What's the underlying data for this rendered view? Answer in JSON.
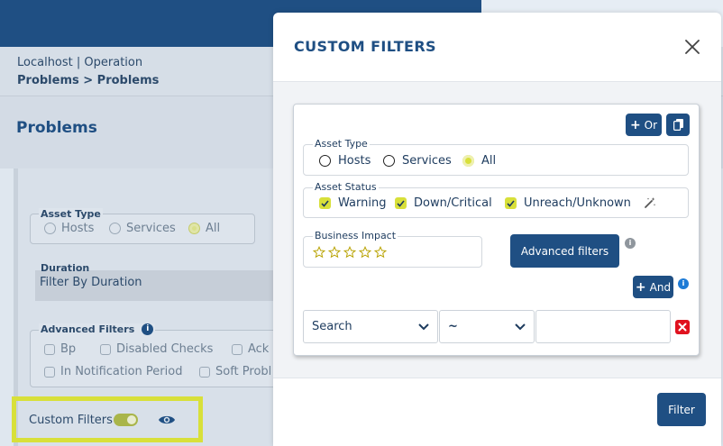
{
  "breadcrumb": {
    "host": "Localhost | Operation",
    "path": "Problems > Problems"
  },
  "page": {
    "title": "Problems"
  },
  "background_filters": {
    "asset_type": {
      "legend": "Asset Type",
      "options": [
        "Hosts",
        "Services",
        "All"
      ],
      "selected": "All"
    },
    "duration": {
      "label": "Duration",
      "value": "Filter By Duration"
    },
    "advanced": {
      "legend": "Advanced Filters",
      "options": [
        "Bp",
        "Disabled Checks",
        "Ack",
        "In Notification Period",
        "Soft Probl"
      ]
    },
    "custom_filters": {
      "label": "Custom Filters",
      "enabled": true
    }
  },
  "modal": {
    "title": "CUSTOM FILTERS",
    "or_label": "Or",
    "and_label": "And",
    "asset_type": {
      "legend": "Asset Type",
      "options": [
        "Hosts",
        "Services",
        "All"
      ],
      "selected": "All"
    },
    "asset_status": {
      "legend": "Asset Status",
      "options": [
        "Warning",
        "Down/Critical",
        "Unreach/Unknown"
      ]
    },
    "business_impact": {
      "legend": "Business Impact",
      "stars": 5,
      "selected": 0
    },
    "advanced_filters_button": "Advanced filters",
    "condition": {
      "field": "Search",
      "operator": "~",
      "value": ""
    },
    "filter_button": "Filter"
  },
  "colors": {
    "primary": "#1f4f83",
    "accent": "#d8e03a",
    "danger": "#e0121f"
  }
}
